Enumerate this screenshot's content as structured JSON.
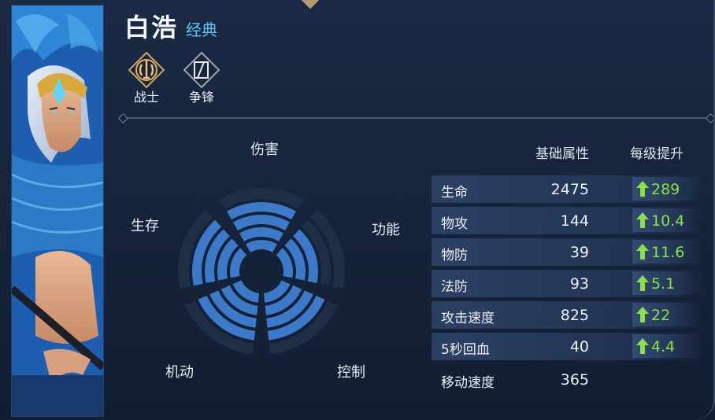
{
  "hero": {
    "name": "白浩",
    "skin": "经典"
  },
  "roles": [
    {
      "label": "战士",
      "icon": "warrior-emblem-icon"
    },
    {
      "label": "争锋",
      "icon": "lane-emblem-icon"
    }
  ],
  "radar": {
    "labels": {
      "top": "伤害",
      "right": "功能",
      "bottom_right": "控制",
      "bottom_left": "机动",
      "left": "生存"
    },
    "levels": {
      "damage": 4,
      "utility": 3,
      "control": 4,
      "mobility": 4,
      "survival": 4
    },
    "max_level": 5,
    "fill_color": "#3c7ac9",
    "empty_color": "#1f2e47"
  },
  "stats": {
    "header_base": "基础属性",
    "header_growth": "每级提升",
    "rows": [
      {
        "name": "生命",
        "value": "2475",
        "growth": "289"
      },
      {
        "name": "物攻",
        "value": "144",
        "growth": "10.4"
      },
      {
        "name": "物防",
        "value": "39",
        "growth": "11.6"
      },
      {
        "name": "法防",
        "value": "93",
        "growth": "5.1"
      },
      {
        "name": "攻击速度",
        "value": "825",
        "growth": "22"
      },
      {
        "name": "5秒回血",
        "value": "40",
        "growth": "4.4"
      },
      {
        "name": "移动速度",
        "value": "365",
        "growth": ""
      }
    ],
    "growth_color": "#8ee04a"
  }
}
